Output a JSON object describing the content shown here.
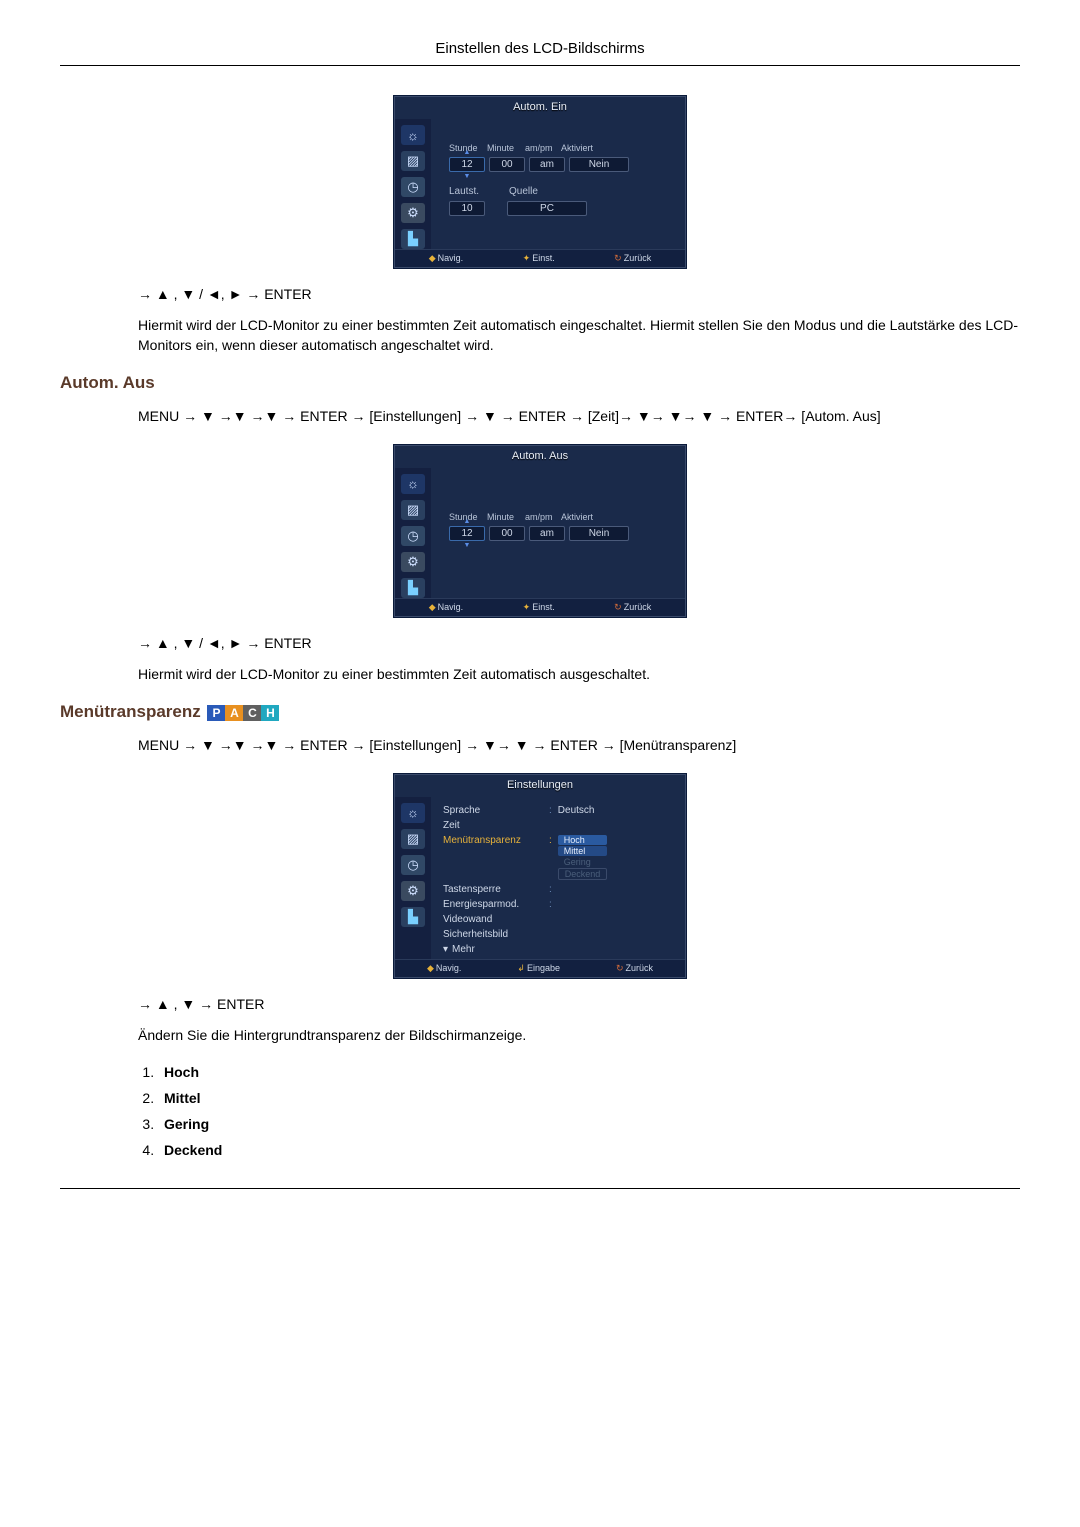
{
  "page_header": "Einstellen des LCD-Bildschirms",
  "osd1": {
    "title": "Autom. Ein",
    "labels": {
      "stunde": "Stunde",
      "minute": "Minute",
      "ampm": "am/pm",
      "aktiviert": "Aktiviert"
    },
    "values": {
      "stunde": "12",
      "minute": "00",
      "ampm": "am",
      "aktiviert": "Nein"
    },
    "row2": {
      "lautst": "Lautst.",
      "quelle": "Quelle"
    },
    "values2": {
      "lautst": "10",
      "quelle": "PC"
    },
    "footer": {
      "nav": "Navig.",
      "einst": "Einst.",
      "zurueck": "Zurück"
    }
  },
  "nav1": "→ ▲ , ▼ / ◄, ► → ENTER",
  "para1": "Hiermit wird der LCD-Monitor zu einer bestimmten Zeit automatisch eingeschaltet. Hiermit stellen Sie den Modus und die Lautstärke des LCD-Monitors ein, wenn dieser automatisch angeschaltet wird.",
  "section2": "Autom. Aus",
  "menu_path2": "MENU → ▼ →▼ →▼ → ENTER → [Einstellungen] → ▼ → ENTER → [Zeit]→ ▼→ ▼→ ▼ → ENTER→ [Autom. Aus]",
  "osd2": {
    "title": "Autom. Aus",
    "labels": {
      "stunde": "Stunde",
      "minute": "Minute",
      "ampm": "am/pm",
      "aktiviert": "Aktiviert"
    },
    "values": {
      "stunde": "12",
      "minute": "00",
      "ampm": "am",
      "aktiviert": "Nein"
    },
    "footer": {
      "nav": "Navig.",
      "einst": "Einst.",
      "zurueck": "Zurück"
    }
  },
  "nav2": "→ ▲ , ▼ / ◄, ► → ENTER",
  "para2": "Hiermit wird der LCD-Monitor zu einer bestimmten Zeit automatisch ausgeschaltet.",
  "section3": "Menütransparenz",
  "badges": {
    "p": "P",
    "a": "A",
    "c": "C",
    "h": "H"
  },
  "menu_path3": "MENU → ▼ →▼ →▼ → ENTER → [Einstellungen] → ▼→ ▼ → ENTER → [Menütransparenz]",
  "osd3": {
    "title": "Einstellungen",
    "rows": {
      "sprache": "Sprache",
      "sprache_val": "Deutsch",
      "zeit": "Zeit",
      "menutransparenz": "Menütransparenz",
      "tastensperre": "Tastensperre",
      "energiespar": "Energiesparmod.",
      "videowand": "Videowand",
      "sicherheitsbild": "Sicherheitsbild",
      "mehr": "Mehr"
    },
    "opts": {
      "hoch": "Hoch",
      "mittel": "Mittel",
      "gering": "Gering",
      "deckend": "Deckend"
    },
    "footer": {
      "nav": "Navig.",
      "eingabe": "Eingabe",
      "zurueck": "Zurück"
    }
  },
  "nav3": "→ ▲ , ▼ → ENTER",
  "para3": "Ändern Sie die Hintergrundtransparenz der Bildschirmanzeige.",
  "list": {
    "i1": "Hoch",
    "i2": "Mittel",
    "i3": "Gering",
    "i4": "Deckend"
  }
}
